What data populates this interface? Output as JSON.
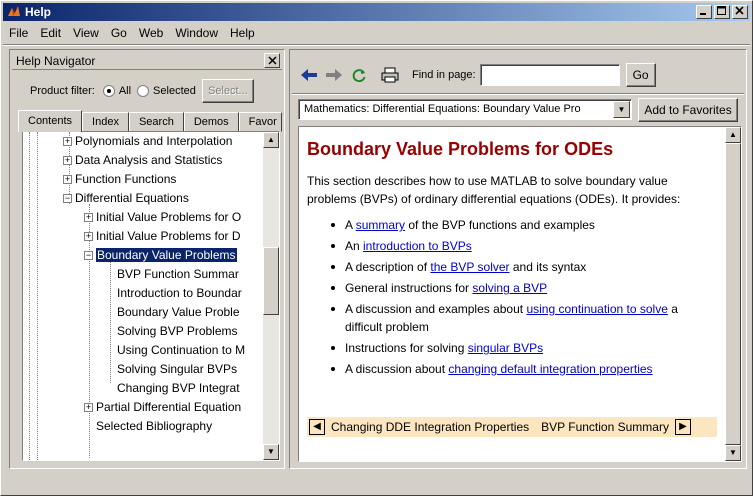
{
  "window": {
    "title": "Help",
    "min_icon": "minimize-icon",
    "max_icon": "maximize-icon",
    "close_icon": "close-icon"
  },
  "menubar": {
    "items": [
      {
        "label": "File",
        "mnemonic": "F"
      },
      {
        "label": "Edit",
        "mnemonic": "E"
      },
      {
        "label": "View",
        "mnemonic": "V"
      },
      {
        "label": "Go",
        "mnemonic": "G"
      },
      {
        "label": "Web",
        "mnemonic": "b"
      },
      {
        "label": "Window",
        "mnemonic": "W"
      },
      {
        "label": "Help",
        "mnemonic": "H"
      }
    ]
  },
  "navigator": {
    "title": "Help Navigator",
    "filter_label": "Product filter:",
    "filter_all": "All",
    "filter_selected": "Selected",
    "select_button": "Select...",
    "tabs": [
      "Contents",
      "Index",
      "Search",
      "Demos",
      "Favor"
    ],
    "active_tab": "Contents",
    "tree": [
      {
        "label": "Polynomials and Interpolation",
        "level": 1,
        "expander": "+"
      },
      {
        "label": "Data Analysis and Statistics",
        "level": 1,
        "expander": "+"
      },
      {
        "label": "Function Functions",
        "level": 1,
        "expander": "+"
      },
      {
        "label": "Differential Equations",
        "level": 1,
        "expander": "-"
      },
      {
        "label": "Initial Value Problems for O",
        "level": 2,
        "expander": "+"
      },
      {
        "label": "Initial Value Problems for D",
        "level": 2,
        "expander": "+"
      },
      {
        "label": "Boundary Value Problems",
        "level": 2,
        "expander": "-",
        "selected": true
      },
      {
        "label": "BVP Function Summar",
        "level": 3
      },
      {
        "label": "Introduction to Boundar",
        "level": 3
      },
      {
        "label": "Boundary Value Proble",
        "level": 3
      },
      {
        "label": "Solving BVP Problems",
        "level": 3
      },
      {
        "label": "Using Continuation to M",
        "level": 3
      },
      {
        "label": "Solving Singular BVPs",
        "level": 3
      },
      {
        "label": "Changing BVP Integrat",
        "level": 3
      },
      {
        "label": "Partial Differential Equation",
        "level": 2,
        "expander": "+"
      },
      {
        "label": "Selected Bibliography",
        "level": 2
      }
    ]
  },
  "browser": {
    "toolbar": {
      "back_icon": "back-arrow-icon",
      "forward_icon": "forward-arrow-icon",
      "refresh_icon": "refresh-icon",
      "print_icon": "print-icon",
      "find_label": "Find in page:",
      "find_value": "",
      "go_label": "Go"
    },
    "location": "Mathematics: Differential Equations: Boundary Value Pro",
    "favorites_label": "Add to Favorites",
    "page": {
      "heading": "Boundary Value Problems for ODEs",
      "intro": "This section describes how to use MATLAB to solve boundary value problems (BVPs) of ordinary differential equations (ODEs). It provides:",
      "items": [
        {
          "pre": "A ",
          "link": "summary",
          "post": " of the BVP functions and examples"
        },
        {
          "pre": "An ",
          "link": "introduction to BVPs",
          "post": ""
        },
        {
          "pre": "A description of ",
          "link": "the BVP solver",
          "post": " and its syntax"
        },
        {
          "pre": "General instructions for ",
          "link": "solving a BVP",
          "post": ""
        },
        {
          "pre": "A discussion and examples about ",
          "link": "using continuation to solve",
          "post": " a difficult problem"
        },
        {
          "pre": "Instructions for solving ",
          "link": "singular BVPs",
          "post": ""
        },
        {
          "pre": "A discussion about ",
          "link": "changing default integration properties",
          "post": ""
        }
      ],
      "prev_label": "Changing DDE Integration Properties",
      "next_label": "BVP Function Summary"
    }
  }
}
